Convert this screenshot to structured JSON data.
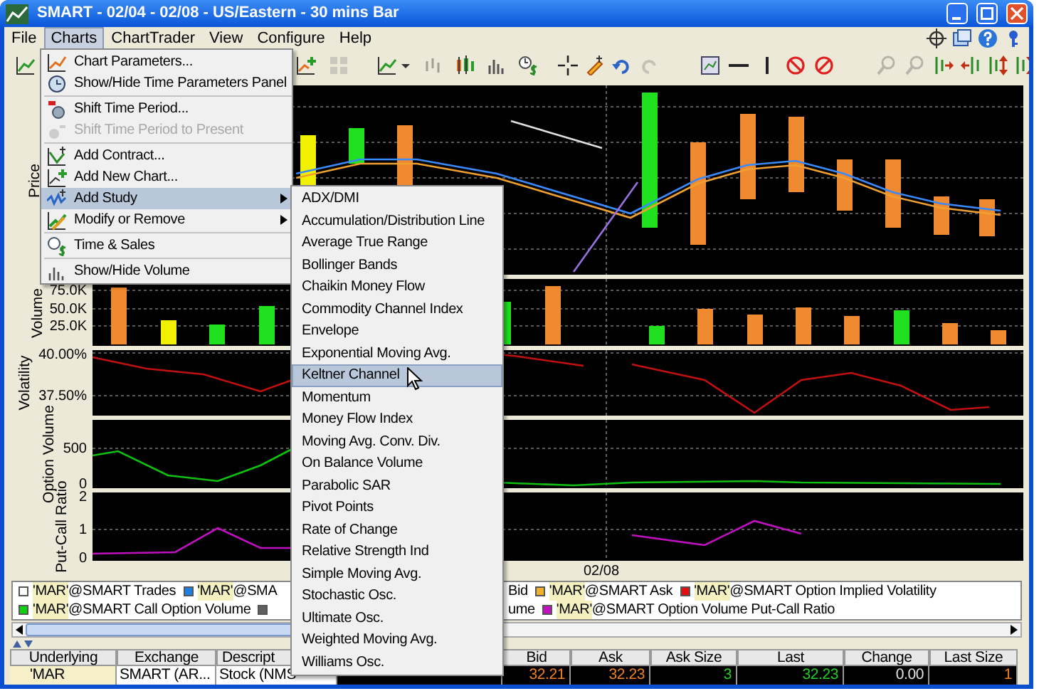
{
  "window": {
    "title": "SMART - 02/04 - 02/08 - US/Eastern - 30 mins Bar"
  },
  "menu_bar": [
    {
      "label": "File",
      "selected": false
    },
    {
      "label": "Charts",
      "selected": true
    },
    {
      "label": "ChartTrader",
      "selected": false
    },
    {
      "label": "View",
      "selected": false
    },
    {
      "label": "Configure",
      "selected": false
    },
    {
      "label": "Help",
      "selected": false
    }
  ],
  "panels": [
    {
      "kind": "price",
      "label": "Price"
    },
    {
      "kind": "volume",
      "label": "Volume",
      "ticks": [
        "75.0K",
        "50.0K",
        "25.0K"
      ]
    },
    {
      "kind": "volatility",
      "label": "Volatility",
      "ticks": [
        "40.00%",
        "37.50%"
      ]
    },
    {
      "kind": "option_volume",
      "label": "Option Volume",
      "ticks": [
        "500",
        "0"
      ]
    },
    {
      "kind": "put_call",
      "label": "Put-Call Ratio",
      "ticks": [
        "2",
        "1",
        "0"
      ]
    }
  ],
  "date_axis": [
    "02/08"
  ],
  "legend": [
    [
      {
        "symbol": "'MAR'",
        "text": "@SMART Trades",
        "color": "#ffffff"
      },
      {
        "symbol": "'MAR'",
        "text": "@SMA",
        "color": "#1e7fe0"
      },
      {
        "text": "Bid"
      },
      {
        "symbol": "'MAR'",
        "text": "@SMART Ask",
        "color": "#f0b030"
      },
      {
        "symbol": "'MAR'",
        "text": "@SMART Option Implied Volatility",
        "color": "#e01010"
      }
    ],
    [
      {
        "symbol": "'MAR'",
        "text": "@SMART Call Option Volume",
        "color": "#10d010"
      },
      {
        "color": "#606060"
      },
      {
        "text": "ume"
      },
      {
        "symbol": "'MAR'",
        "text": "@SMART Option Volume Put-Call Ratio",
        "color": "#c010c0"
      }
    ]
  ],
  "table": {
    "columns": [
      "Underlying",
      "Exchange",
      "Descript",
      "Bid",
      "Ask",
      "Ask Size",
      "Last",
      "Change",
      "Last Size"
    ],
    "row": [
      {
        "text": "'MAR"
      },
      {
        "text": "SMART (AR..."
      },
      {
        "text": "Stock (NMS"
      },
      {
        "text": "32.21",
        "color": "#f08020"
      },
      {
        "text": "32.23",
        "color": "#f08020"
      },
      {
        "text": "3",
        "color": "#20d020"
      },
      {
        "text": "32.23",
        "color": "#20d020"
      },
      {
        "text": "0.00",
        "color": "#e0e0e0"
      },
      {
        "text": "1",
        "color": "#f08020"
      }
    ]
  },
  "charts_menu": [
    {
      "kind": "item",
      "label": "Chart Parameters...",
      "selected": false,
      "disabled": false,
      "submenu": false
    },
    {
      "kind": "item",
      "label": "Show/Hide Time Parameters Panel",
      "selected": false,
      "disabled": false,
      "submenu": false
    },
    {
      "kind": "separator"
    },
    {
      "kind": "item",
      "label": "Shift Time Period...",
      "selected": false,
      "disabled": false,
      "submenu": false
    },
    {
      "kind": "item",
      "label": "Shift Time Period to Present",
      "selected": false,
      "disabled": true,
      "submenu": false
    },
    {
      "kind": "separator"
    },
    {
      "kind": "item",
      "label": "Add Contract...",
      "selected": false,
      "disabled": false,
      "submenu": false
    },
    {
      "kind": "item",
      "label": "Add New Chart...",
      "selected": false,
      "disabled": false,
      "submenu": false
    },
    {
      "kind": "item",
      "label": "Add Study",
      "selected": true,
      "disabled": false,
      "submenu": true
    },
    {
      "kind": "item",
      "label": "Modify or Remove",
      "selected": false,
      "disabled": false,
      "submenu": true
    },
    {
      "kind": "separator"
    },
    {
      "kind": "item",
      "label": "Time & Sales",
      "selected": false,
      "disabled": false,
      "submenu": false
    },
    {
      "kind": "separator"
    },
    {
      "kind": "item",
      "label": "Show/Hide Volume",
      "selected": false,
      "disabled": false,
      "submenu": false
    }
  ],
  "study_menu": [
    {
      "label": "ADX/DMI",
      "selected": false
    },
    {
      "label": "Accumulation/Distribution Line",
      "selected": false
    },
    {
      "label": "Average True Range",
      "selected": false
    },
    {
      "label": "Bollinger Bands",
      "selected": false
    },
    {
      "label": "Chaikin Money Flow",
      "selected": false
    },
    {
      "label": "Commodity Channel Index",
      "selected": false
    },
    {
      "label": "Envelope",
      "selected": false
    },
    {
      "label": "Exponential Moving Avg.",
      "selected": false
    },
    {
      "label": "Keltner Channel",
      "selected": true
    },
    {
      "label": "Momentum",
      "selected": false
    },
    {
      "label": "Money Flow Index",
      "selected": false
    },
    {
      "label": "Moving Avg. Conv. Div.",
      "selected": false
    },
    {
      "label": "On Balance Volume",
      "selected": false
    },
    {
      "label": "Parabolic SAR",
      "selected": false
    },
    {
      "label": "Pivot Points",
      "selected": false
    },
    {
      "label": "Rate of Change",
      "selected": false
    },
    {
      "label": "Relative Strength Ind",
      "selected": false
    },
    {
      "label": "Simple Moving Avg.",
      "selected": false
    },
    {
      "label": "Stochastic Osc.",
      "selected": false
    },
    {
      "label": "Ultimate Osc.",
      "selected": false
    },
    {
      "label": "Weighted Moving Avg.",
      "selected": false
    },
    {
      "label": "Williams Osc.",
      "selected": false
    }
  ]
}
